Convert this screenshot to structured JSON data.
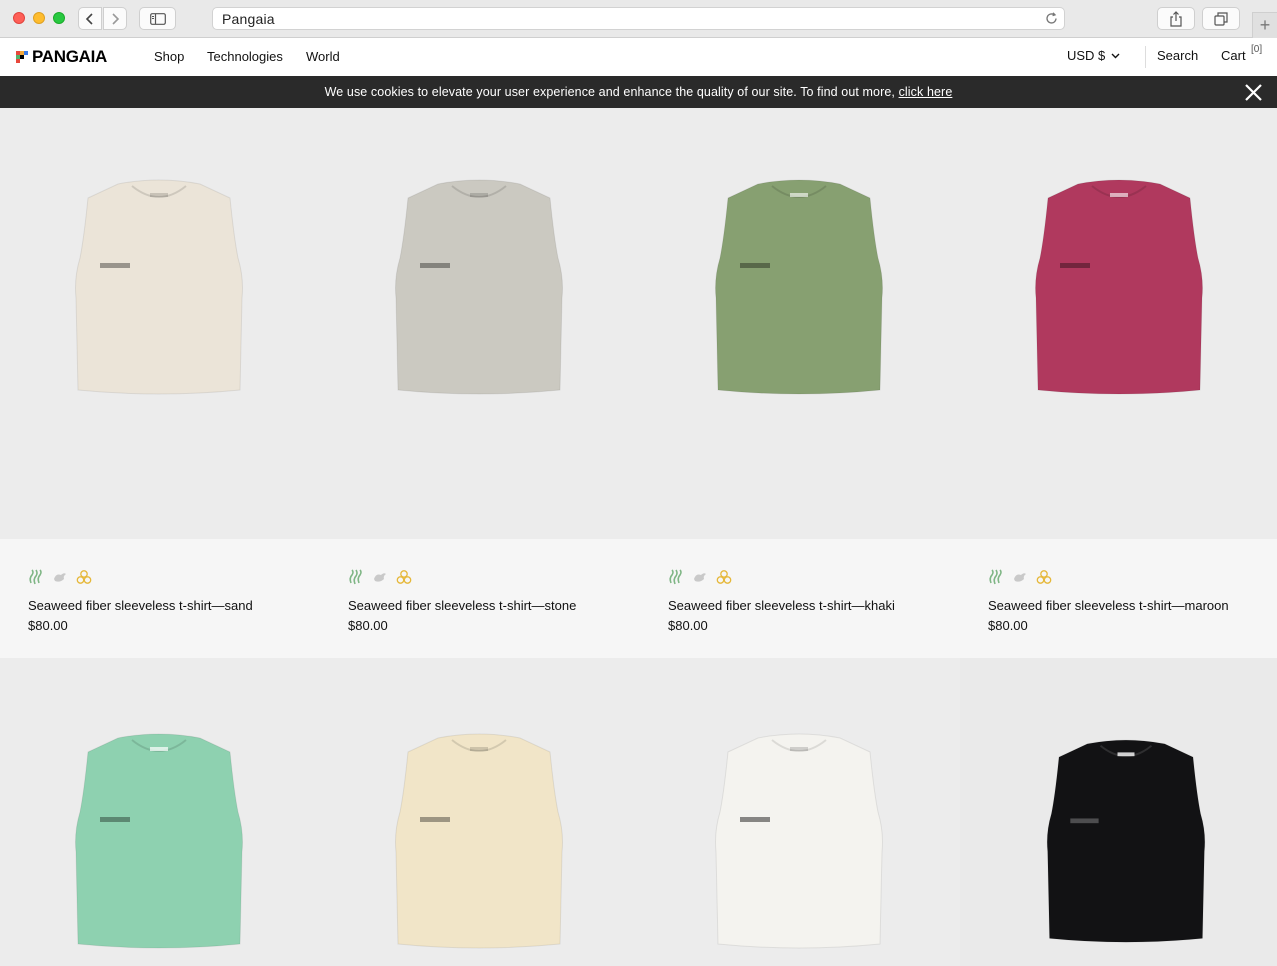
{
  "browser": {
    "url_text": "Pangaia"
  },
  "header": {
    "logo_text": "PANGAIA",
    "nav": [
      "Shop",
      "Technologies",
      "World"
    ],
    "currency": "USD $",
    "search": "Search",
    "cart": "Cart",
    "cart_count": "[0]"
  },
  "cookie": {
    "text": "We use cookies to elevate your user experience and enhance the quality of our site. To find out more, ",
    "link": "click here"
  },
  "colors": {
    "badge_green": "#7fb685",
    "badge_gray": "#c9c9c9",
    "badge_yellow": "#e6b83a",
    "banner_bg": "#2a2a2a"
  },
  "products": [
    {
      "name": "Seaweed fiber sleeveless t-shirt—sand",
      "price": "$80.00",
      "color": "#ebe4d8"
    },
    {
      "name": "Seaweed fiber sleeveless t-shirt—stone",
      "price": "$80.00",
      "color": "#cbc9c1"
    },
    {
      "name": "Seaweed fiber sleeveless t-shirt—khaki",
      "price": "$80.00",
      "color": "#87a071"
    },
    {
      "name": "Seaweed fiber sleeveless t-shirt—maroon",
      "price": "$80.00",
      "color": "#b0395e"
    },
    {
      "color": "#8ed1b0"
    },
    {
      "color": "#f1e5c8"
    },
    {
      "color": "#f4f3ef"
    },
    {
      "color": "#121214"
    }
  ]
}
